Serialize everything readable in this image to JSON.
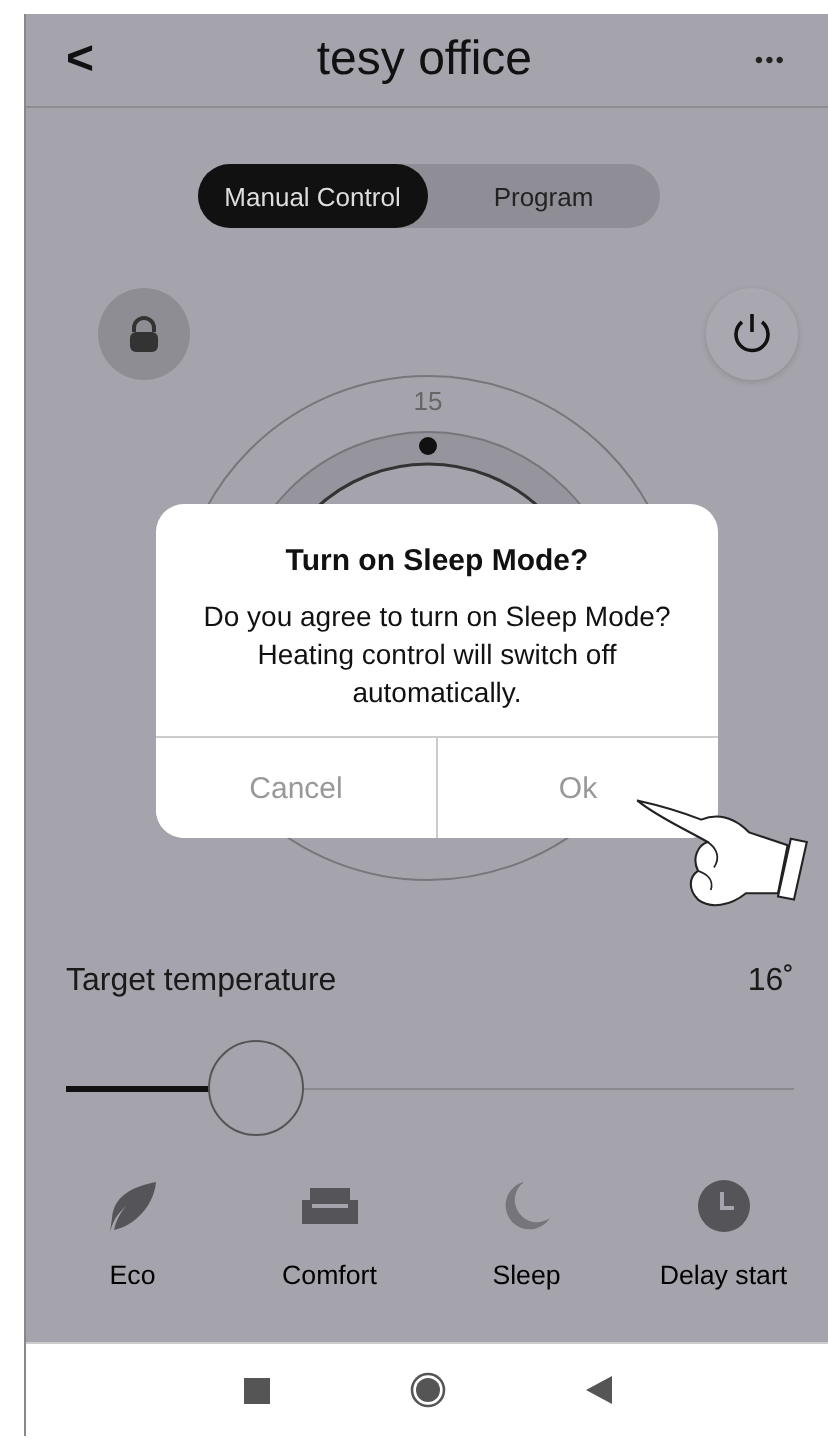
{
  "header": {
    "title": "tesy office",
    "back": "<",
    "more": "•••"
  },
  "segments": [
    {
      "label": "Manual Control",
      "selected": true
    },
    {
      "label": "Program",
      "selected": false
    }
  ],
  "dial": {
    "value": "15"
  },
  "target": {
    "label": "Target temperature",
    "reading": "16˚",
    "level": 0.26
  },
  "modes": [
    {
      "kind": "eco",
      "label": "Eco"
    },
    {
      "kind": "comfort",
      "label": "Comfort"
    },
    {
      "kind": "sleep",
      "label": "Sleep"
    },
    {
      "kind": "delay",
      "label": "Delay start"
    }
  ],
  "dialog": {
    "title": "Turn on Sleep Mode?",
    "message": "Do you agree to turn on Sleep Mode? Heating control will switch off automatically.",
    "buttons": [
      "Cancel",
      "Ok"
    ]
  }
}
